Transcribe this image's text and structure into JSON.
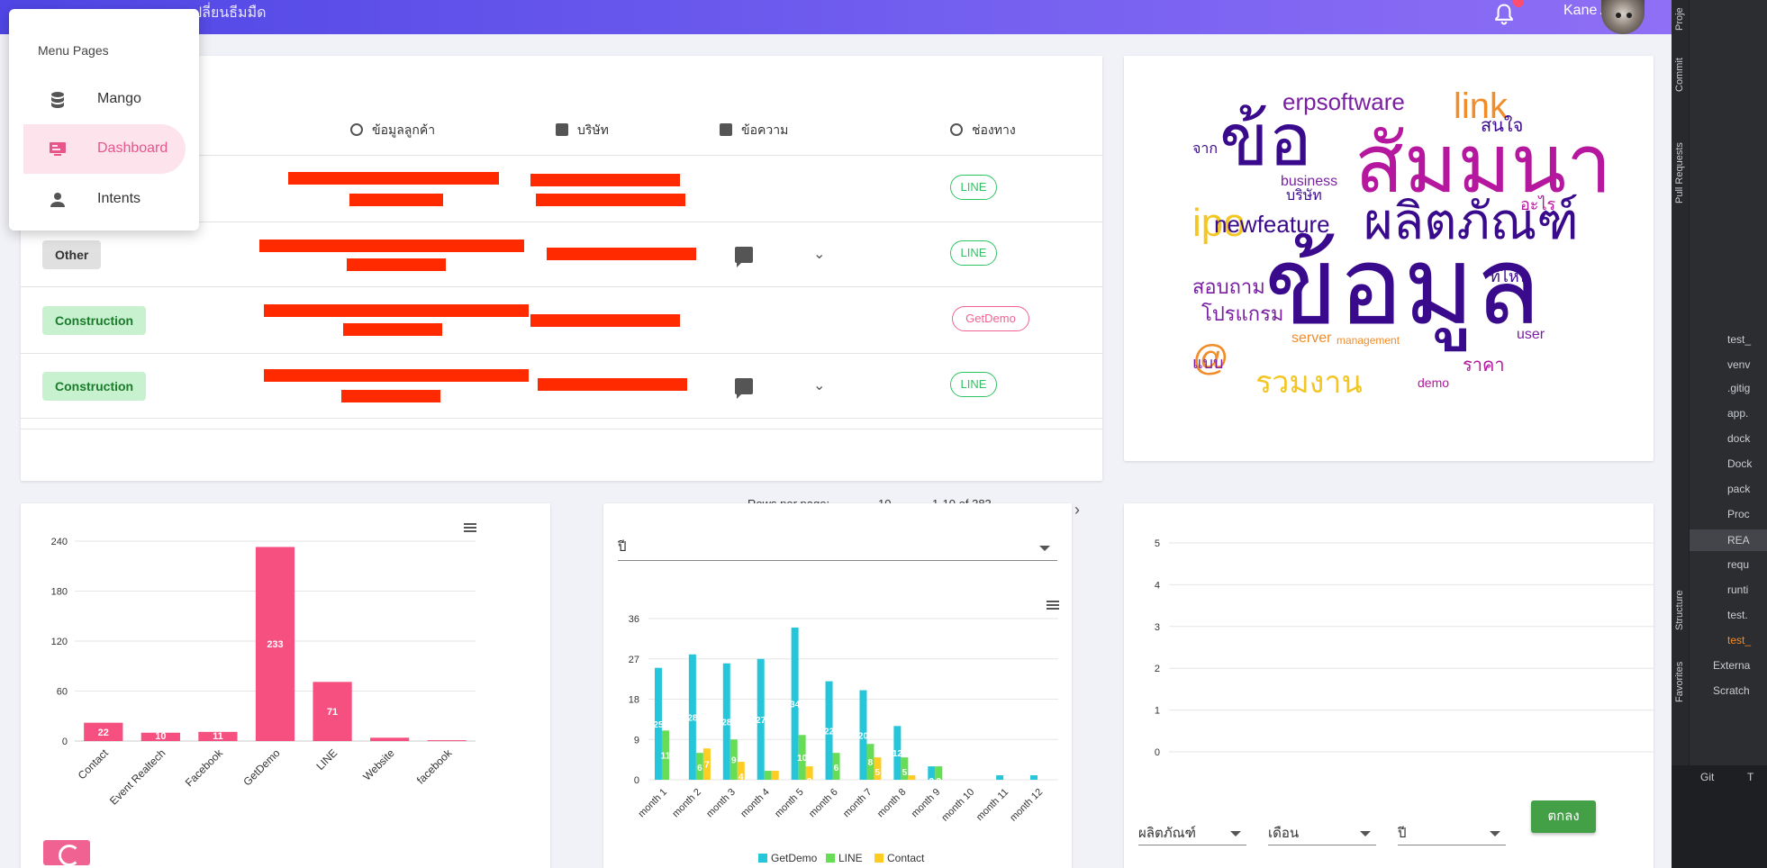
{
  "topbar": {
    "title": "ปลี่ยนธีมมืด",
    "username": "Kane AI"
  },
  "menu": {
    "title": "Menu Pages",
    "items": [
      {
        "label": "Mango",
        "icon": "database-icon",
        "active": false
      },
      {
        "label": "Dashboard",
        "icon": "monitor-icon",
        "active": true
      },
      {
        "label": "Intents",
        "icon": "person-icon",
        "active": false
      }
    ]
  },
  "table": {
    "headers": [
      "ข้อมูลลูกค้า",
      "บริษัท",
      "ข้อความ",
      "ช่องทาง"
    ],
    "rows": [
      {
        "category": "",
        "channel": "LINE",
        "has_message": false
      },
      {
        "category": "Other",
        "channel": "LINE",
        "has_message": true
      },
      {
        "category": "Construction",
        "channel": "GetDemo",
        "has_message": false
      },
      {
        "category": "Construction",
        "channel": "LINE",
        "has_message": true
      }
    ],
    "pagination": {
      "rows_per_page_label": "Rows per page:",
      "rows_per_page": "10",
      "range": "1-10 of 383"
    }
  },
  "wordcloud": {
    "colors": {
      "dark": "#3a0a8c",
      "purple": "#7a1fa2",
      "magenta": "#b5179e",
      "orange": "#f28c28",
      "yellow": "#f3c623"
    }
  },
  "channel_chart": {
    "chart_data": {
      "type": "bar",
      "categories": [
        "Contact",
        "Event Realtech",
        "Facebook",
        "GetDemo",
        "LINE",
        "Website",
        "facebook"
      ],
      "values": [
        22,
        10,
        11,
        233,
        71,
        4,
        1
      ],
      "labels": [
        "22",
        "10",
        "11",
        "233",
        "71",
        "",
        ""
      ],
      "yticks": [
        0,
        60,
        120,
        180,
        240
      ],
      "ylim": [
        0,
        240
      ],
      "color": "#f5507f"
    }
  },
  "monthly_chart": {
    "year_label": "ปี",
    "chart_data": {
      "type": "bar",
      "categories": [
        "month 1",
        "month 2",
        "month 3",
        "month 4",
        "month 5",
        "month 6",
        "month 7",
        "month 8",
        "month 9",
        "month 10",
        "month 11",
        "month 12"
      ],
      "series": [
        {
          "name": "GetDemo",
          "color": "#26c6da",
          "values": [
            25,
            28,
            26,
            27,
            34,
            22,
            20,
            12,
            3,
            0,
            1,
            1
          ],
          "labels": [
            "25",
            "28",
            "28",
            "27",
            "34",
            "22",
            "20",
            "12",
            "3",
            "",
            "",
            ""
          ]
        },
        {
          "name": "LINE",
          "color": "#66dd55",
          "values": [
            11,
            6,
            9,
            2,
            10,
            6,
            8,
            5,
            3,
            0,
            0,
            0
          ],
          "labels": [
            "11",
            "6",
            "9",
            "2",
            "10",
            "6",
            "8",
            "5",
            "3",
            "",
            "",
            ""
          ]
        },
        {
          "name": "Contact",
          "color": "#ffcc22",
          "values": [
            0,
            7,
            4,
            2,
            3,
            0,
            5,
            1,
            0,
            0,
            0,
            0
          ],
          "labels": [
            "",
            "7",
            "4",
            "2",
            "3",
            "",
            "5",
            "",
            "",
            "",
            "",
            ""
          ]
        }
      ],
      "yticks": [
        0,
        9,
        18,
        27,
        36
      ],
      "ylim": [
        0,
        36
      ]
    }
  },
  "product_chart": {
    "chart_data": {
      "type": "line",
      "yticks": [
        0,
        1,
        2,
        3,
        4,
        5
      ],
      "ylim": [
        0,
        5
      ]
    },
    "filters": {
      "product": "ผลิตภัณฑ์",
      "month": "เดือน",
      "year": "ปี"
    },
    "submit": "ตกลง"
  },
  "ide": {
    "vtabs": [
      "Proje",
      "Commit",
      "Pull Requests",
      "Structure",
      "Favorites"
    ],
    "files": [
      ".gitig",
      "app.",
      "dock",
      "Dock",
      "pack",
      "Proc",
      "REA",
      "requ",
      "runti",
      "test.",
      "test_"
    ],
    "folders": [
      "test_",
      "venv",
      "Externa",
      "Scratch"
    ],
    "bottom": [
      "Git",
      "T"
    ]
  }
}
